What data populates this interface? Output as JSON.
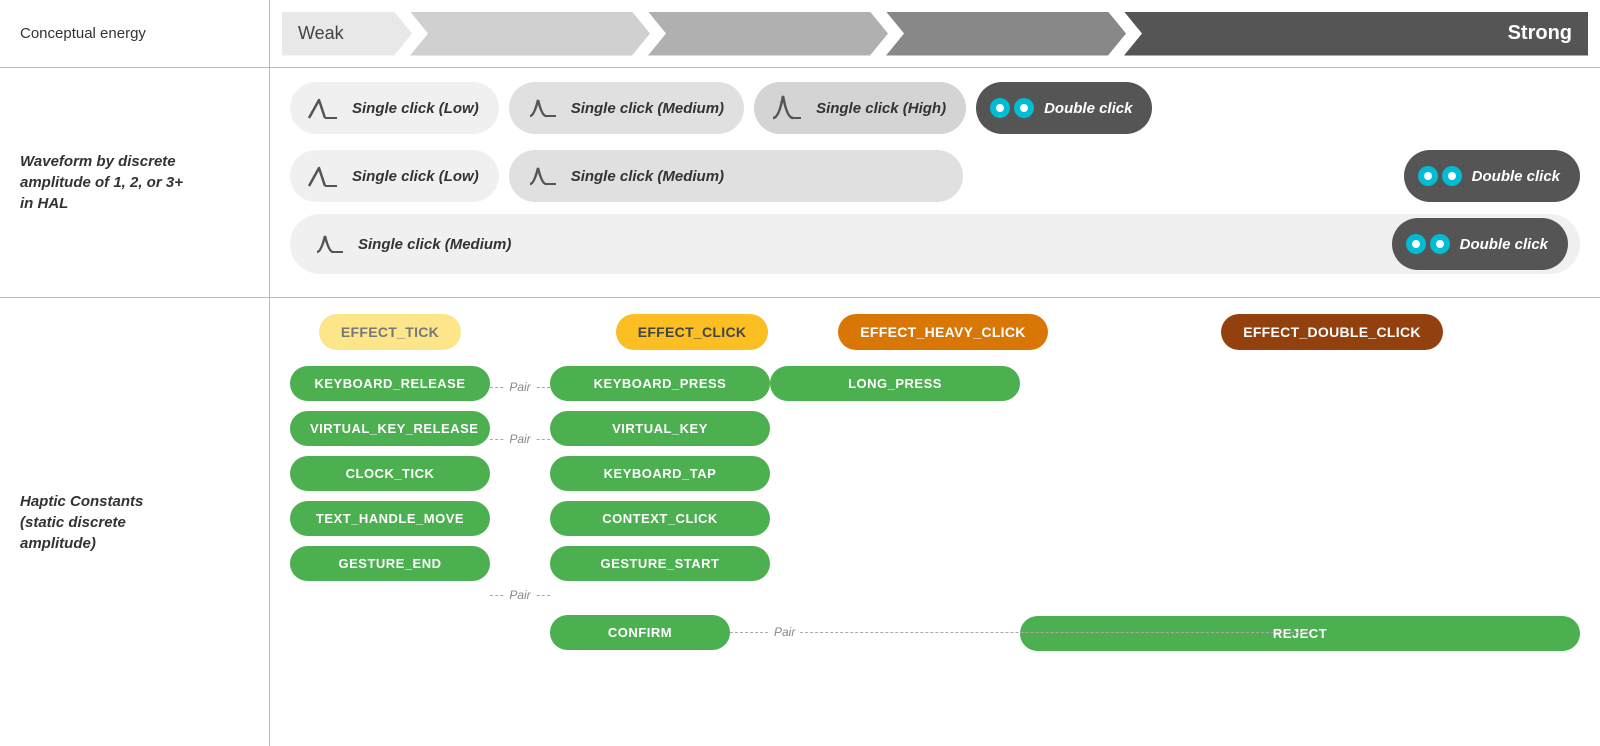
{
  "labels": {
    "conceptual_energy": "Conceptual energy",
    "waveform": "Waveform by discrete\namplitude of 1, 2, or 3+\nin HAL",
    "haptic": "Haptic Constants\n(static discrete\namplitude)"
  },
  "energy": {
    "weak": "Weak",
    "strong": "Strong"
  },
  "waveforms": {
    "row1": [
      {
        "label": "Single click (Low)",
        "type": "low"
      },
      {
        "label": "Single click (Medium)",
        "type": "medium"
      },
      {
        "label": "Single click (High)",
        "type": "high"
      },
      {
        "label": "Double click",
        "type": "double"
      }
    ],
    "row2": [
      {
        "label": "Single click (Low)",
        "type": "low"
      },
      {
        "label": "Single click (Medium)",
        "type": "medium"
      },
      {
        "label": "Double click",
        "type": "double"
      }
    ],
    "row3": [
      {
        "label": "Single click (Medium)",
        "type": "medium"
      },
      {
        "label": "Double click",
        "type": "double"
      }
    ]
  },
  "effects": {
    "tick": "EFFECT_TICK",
    "click": "EFFECT_CLICK",
    "heavy_click": "EFFECT_HEAVY_CLICK",
    "double_click": "EFFECT_DOUBLE_CLICK"
  },
  "haptic_constants": {
    "col1": [
      "KEYBOARD_RELEASE",
      "VIRTUAL_KEY_RELEASE",
      "CLOCK_TICK",
      "TEXT_HANDLE_MOVE",
      "GESTURE_END"
    ],
    "col2": [
      "KEYBOARD_PRESS",
      "VIRTUAL_KEY",
      "KEYBOARD_TAP",
      "CONTEXT_CLICK",
      "GESTURE_START",
      "CONFIRM"
    ],
    "col3": [
      "LONG_PRESS"
    ],
    "col4": [
      "REJECT"
    ],
    "pairs": [
      {
        "left": "KEYBOARD_RELEASE",
        "right": "KEYBOARD_PRESS"
      },
      {
        "left": "VIRTUAL_KEY_RELEASE",
        "right": "VIRTUAL_KEY"
      },
      {
        "left": "GESTURE_END",
        "right": "GESTURE_START"
      },
      {
        "left": "CONFIRM",
        "right": "REJECT",
        "long": true
      }
    ],
    "pair_label": "Pair"
  }
}
